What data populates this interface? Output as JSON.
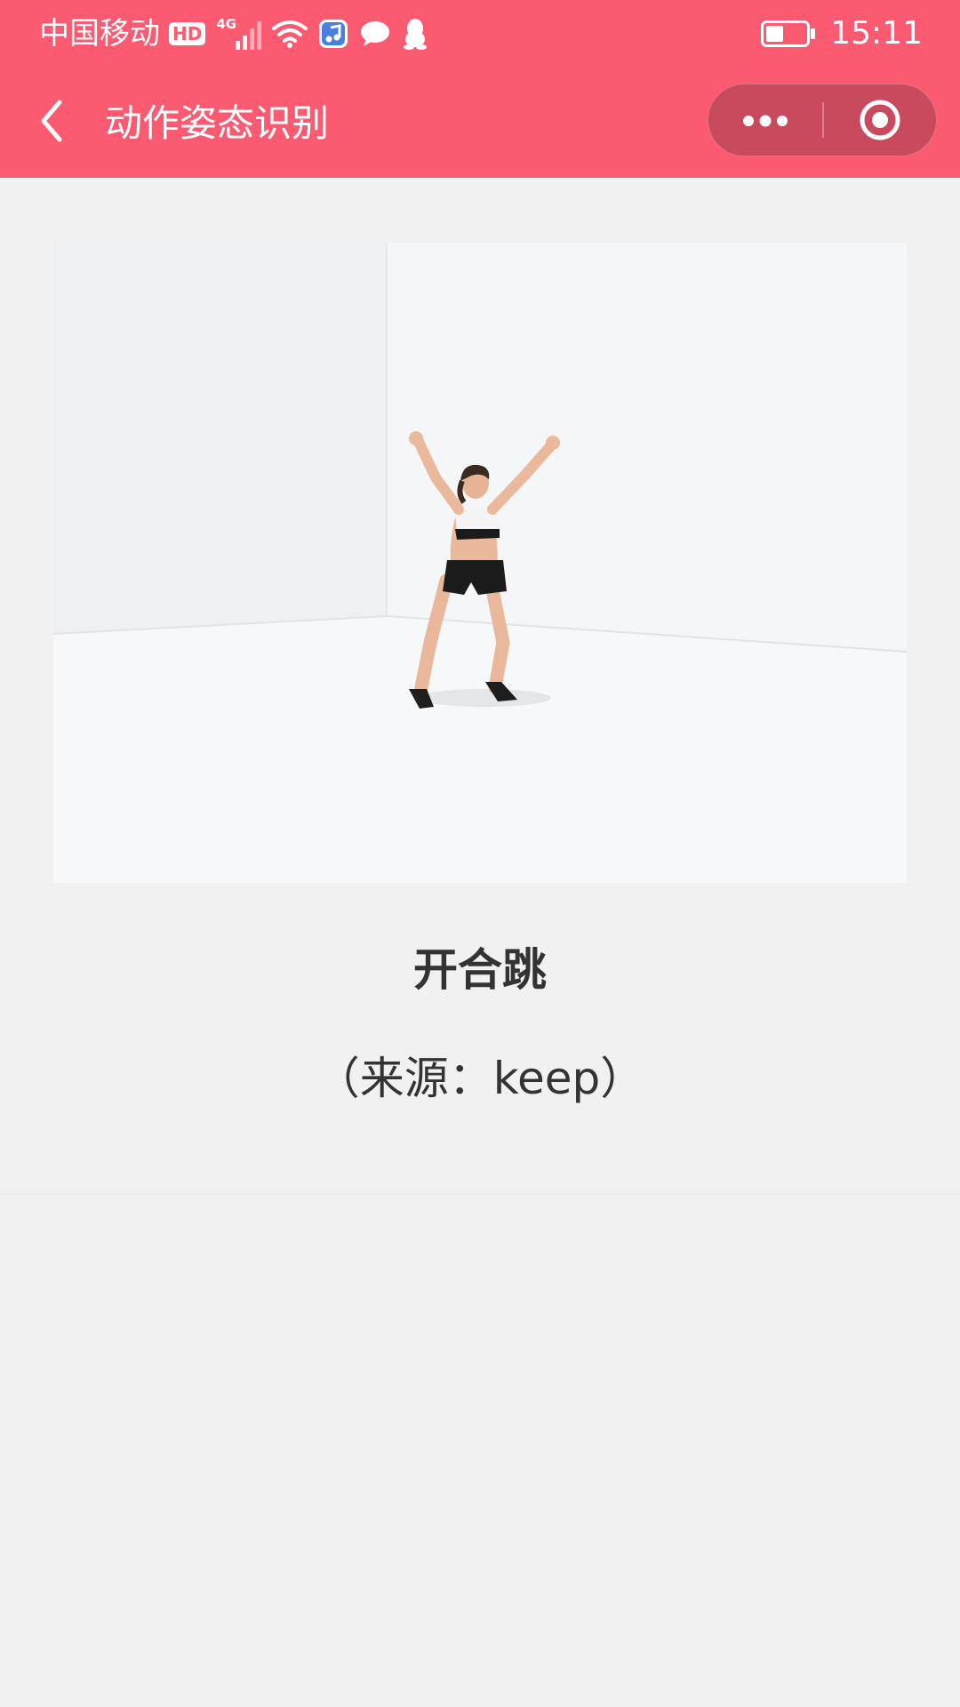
{
  "status_bar": {
    "carrier": "中国移动",
    "hd_badge": "HD",
    "network": "4G",
    "time": "15:11",
    "battery_level": 0.45
  },
  "nav": {
    "title": "动作姿态识别"
  },
  "content": {
    "exercise_name": "开合跳",
    "source": "（来源：keep）"
  },
  "colors": {
    "accent": "#fc5a71",
    "capsule": "#c9495d",
    "background": "#f1f1f1",
    "text": "#333333"
  },
  "icons": [
    "back-arrow-icon",
    "more-dots-icon",
    "close-target-icon",
    "wifi-icon",
    "signal-icon",
    "music-app-icon",
    "chat-bubble-icon",
    "qq-penguin-icon",
    "battery-icon"
  ]
}
